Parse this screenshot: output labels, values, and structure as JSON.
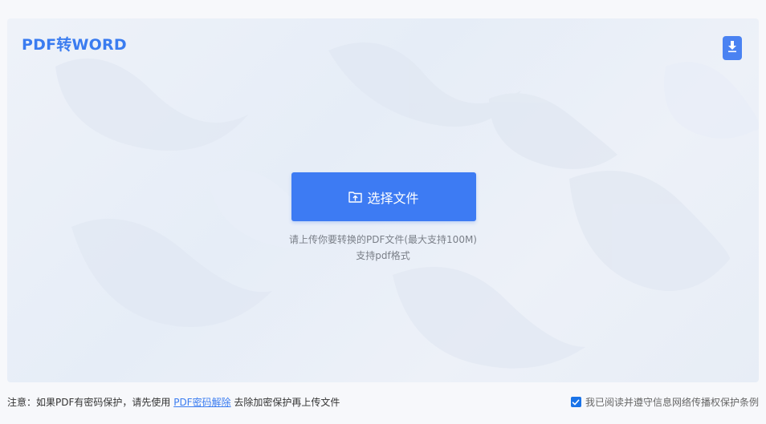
{
  "header": {
    "title": "PDF转WORD"
  },
  "upload": {
    "button_label": "选择文件",
    "hint_primary": "请上传你要转换的PDF文件(最大支持100M)",
    "hint_secondary": "支持pdf格式"
  },
  "footer": {
    "notice_prefix": "注意：如果PDF有密码保护，请先使用 ",
    "notice_link": "PDF密码解除",
    "notice_suffix": " 去除加密保护再上传文件",
    "agreement_label": "我已阅读并遵守信息网络传播权保护条例",
    "agreement_checked": true
  },
  "icons": {
    "download": "download-icon",
    "folder": "folder-upload-icon",
    "checkbox": "checkbox-checked-icon"
  },
  "colors": {
    "accent": "#3d7bf3",
    "title": "#3a7cf0",
    "hint": "#7a7f88"
  }
}
